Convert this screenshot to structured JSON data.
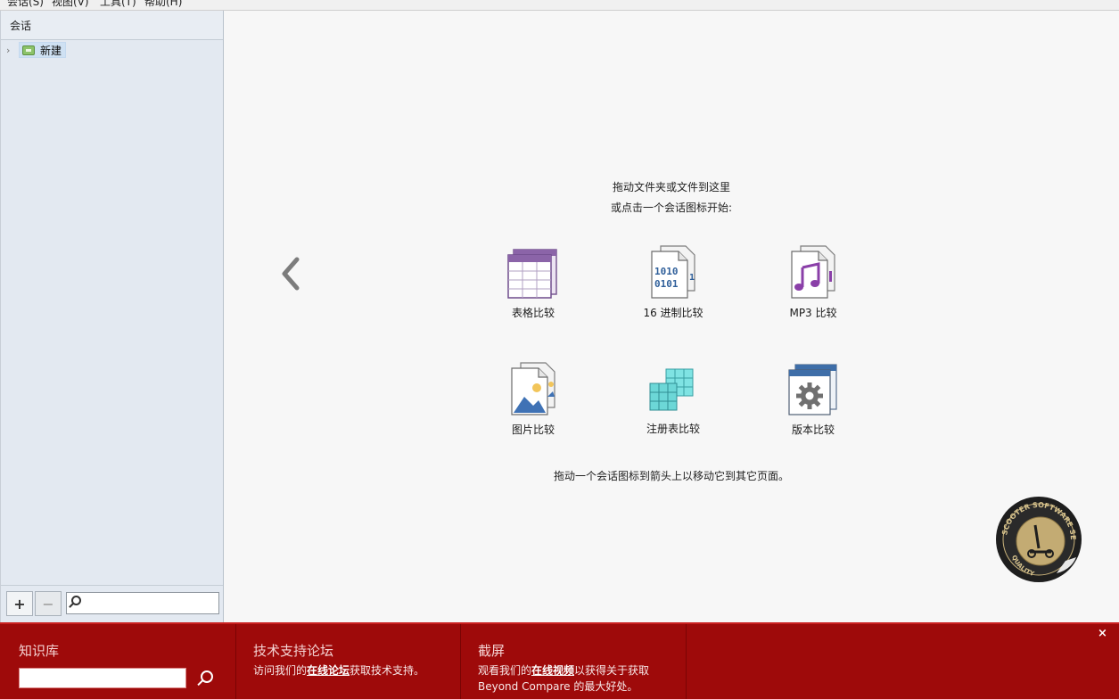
{
  "menu": {
    "items": [
      "会话(S)",
      "视图(V)",
      "工具(T)",
      "帮助(H)"
    ]
  },
  "sidebar": {
    "header": "会话",
    "tree": [
      {
        "label": "新建",
        "icon": "new-session-folder-icon"
      }
    ],
    "add_label": "+",
    "remove_label": "−",
    "search_placeholder": ""
  },
  "main": {
    "instruction_line1": "拖动文件夹或文件到这里",
    "instruction_line2": "或点击一个会话图标开始:",
    "footer_hint": "拖动一个会话图标到箭头上以移动它到其它页面。",
    "tiles": [
      {
        "label": "表格比较",
        "icon": "table-compare-icon"
      },
      {
        "label": "16 进制比较",
        "icon": "hex-compare-icon"
      },
      {
        "label": "MP3 比较",
        "icon": "mp3-compare-icon"
      },
      {
        "label": "图片比较",
        "icon": "picture-compare-icon"
      },
      {
        "label": "注册表比较",
        "icon": "registry-compare-icon"
      },
      {
        "label": "版本比较",
        "icon": "version-compare-icon"
      }
    ]
  },
  "banner": {
    "knowledge": {
      "title": "知识库",
      "input_value": ""
    },
    "forum": {
      "title": "技术支持论坛",
      "text_before": "访问我们的",
      "link": "在线论坛",
      "text_after": "获取技术支持。"
    },
    "screencast": {
      "title": "截屏",
      "text_before": "观看我们的",
      "link": "在线视频",
      "text_after": "以获得关于获取",
      "line2": "Beyond Compare 的最大好处。"
    },
    "close_label": "×"
  },
  "colors": {
    "banner": "#9e0a0a",
    "sidebar": "#e3e9f1",
    "selection": "#cfe1f3"
  }
}
